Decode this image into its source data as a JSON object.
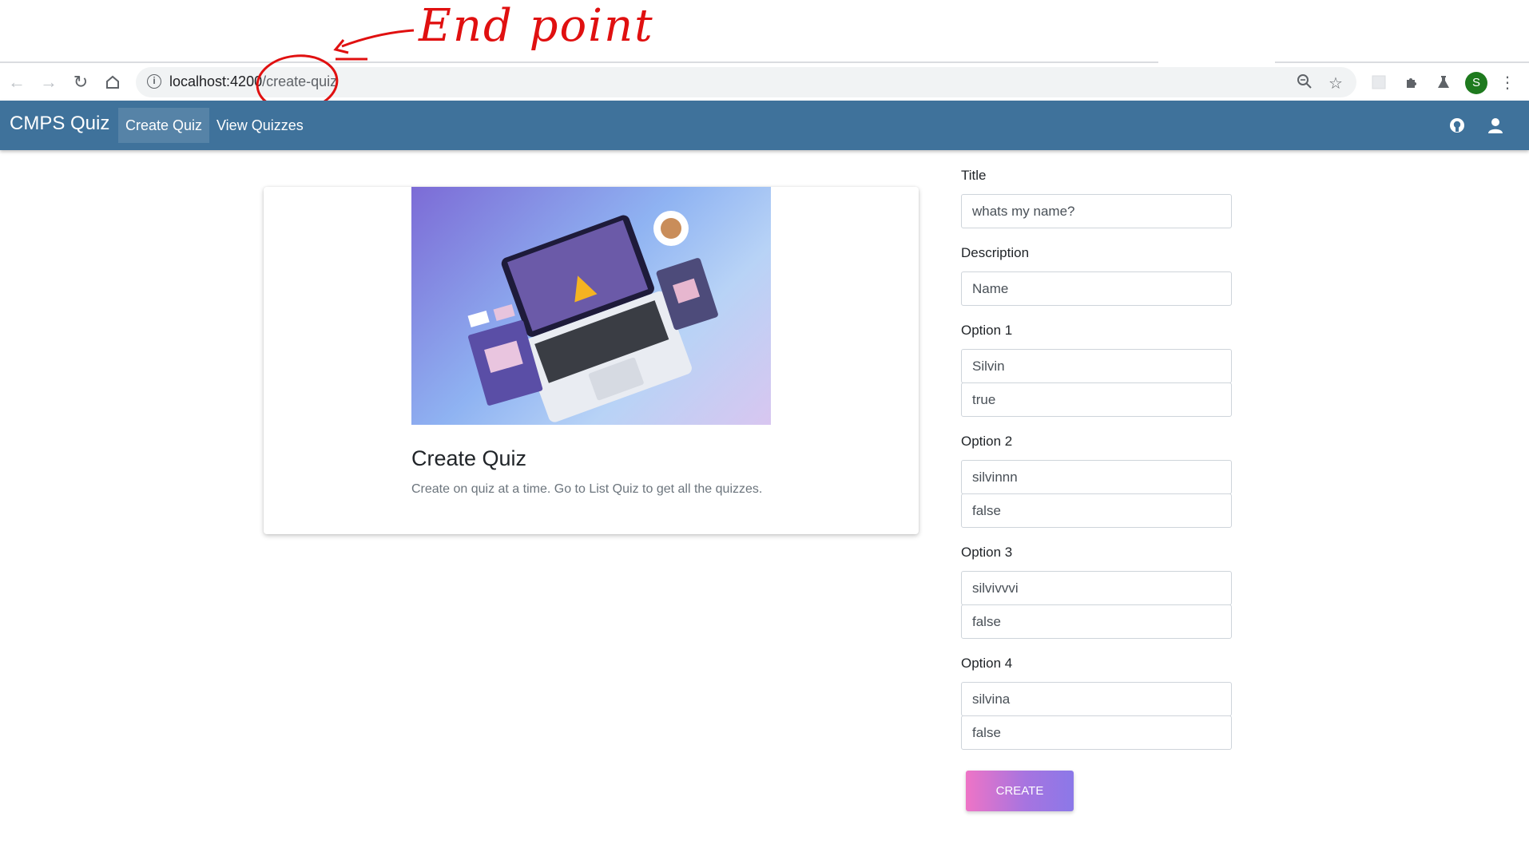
{
  "annotation": {
    "text": "End point"
  },
  "browser": {
    "url_host": "localhost:4200",
    "url_path": "/create-quiz",
    "profile_initial": "S"
  },
  "navbar": {
    "brand": "CMPS Quiz",
    "links": [
      {
        "label": "Create Quiz",
        "active": true
      },
      {
        "label": "View Quizzes",
        "active": false
      }
    ]
  },
  "card": {
    "title": "Create Quiz",
    "text": "Create on quiz at a time. Go to List Quiz to get all the quizzes."
  },
  "form": {
    "title_label": "Title",
    "title_value": "whats my name?",
    "description_label": "Description",
    "description_value": "Name",
    "options": [
      {
        "label": "Option 1",
        "text": "Silvin",
        "correct": "true"
      },
      {
        "label": "Option 2",
        "text": "silvinnn",
        "correct": "false"
      },
      {
        "label": "Option 3",
        "text": "silvivvvi",
        "correct": "false"
      },
      {
        "label": "Option 4",
        "text": "silvina",
        "correct": "false"
      }
    ],
    "submit_label": "CREATE"
  },
  "colors": {
    "navbar": "#3f729b",
    "annotation": "#e01010"
  }
}
